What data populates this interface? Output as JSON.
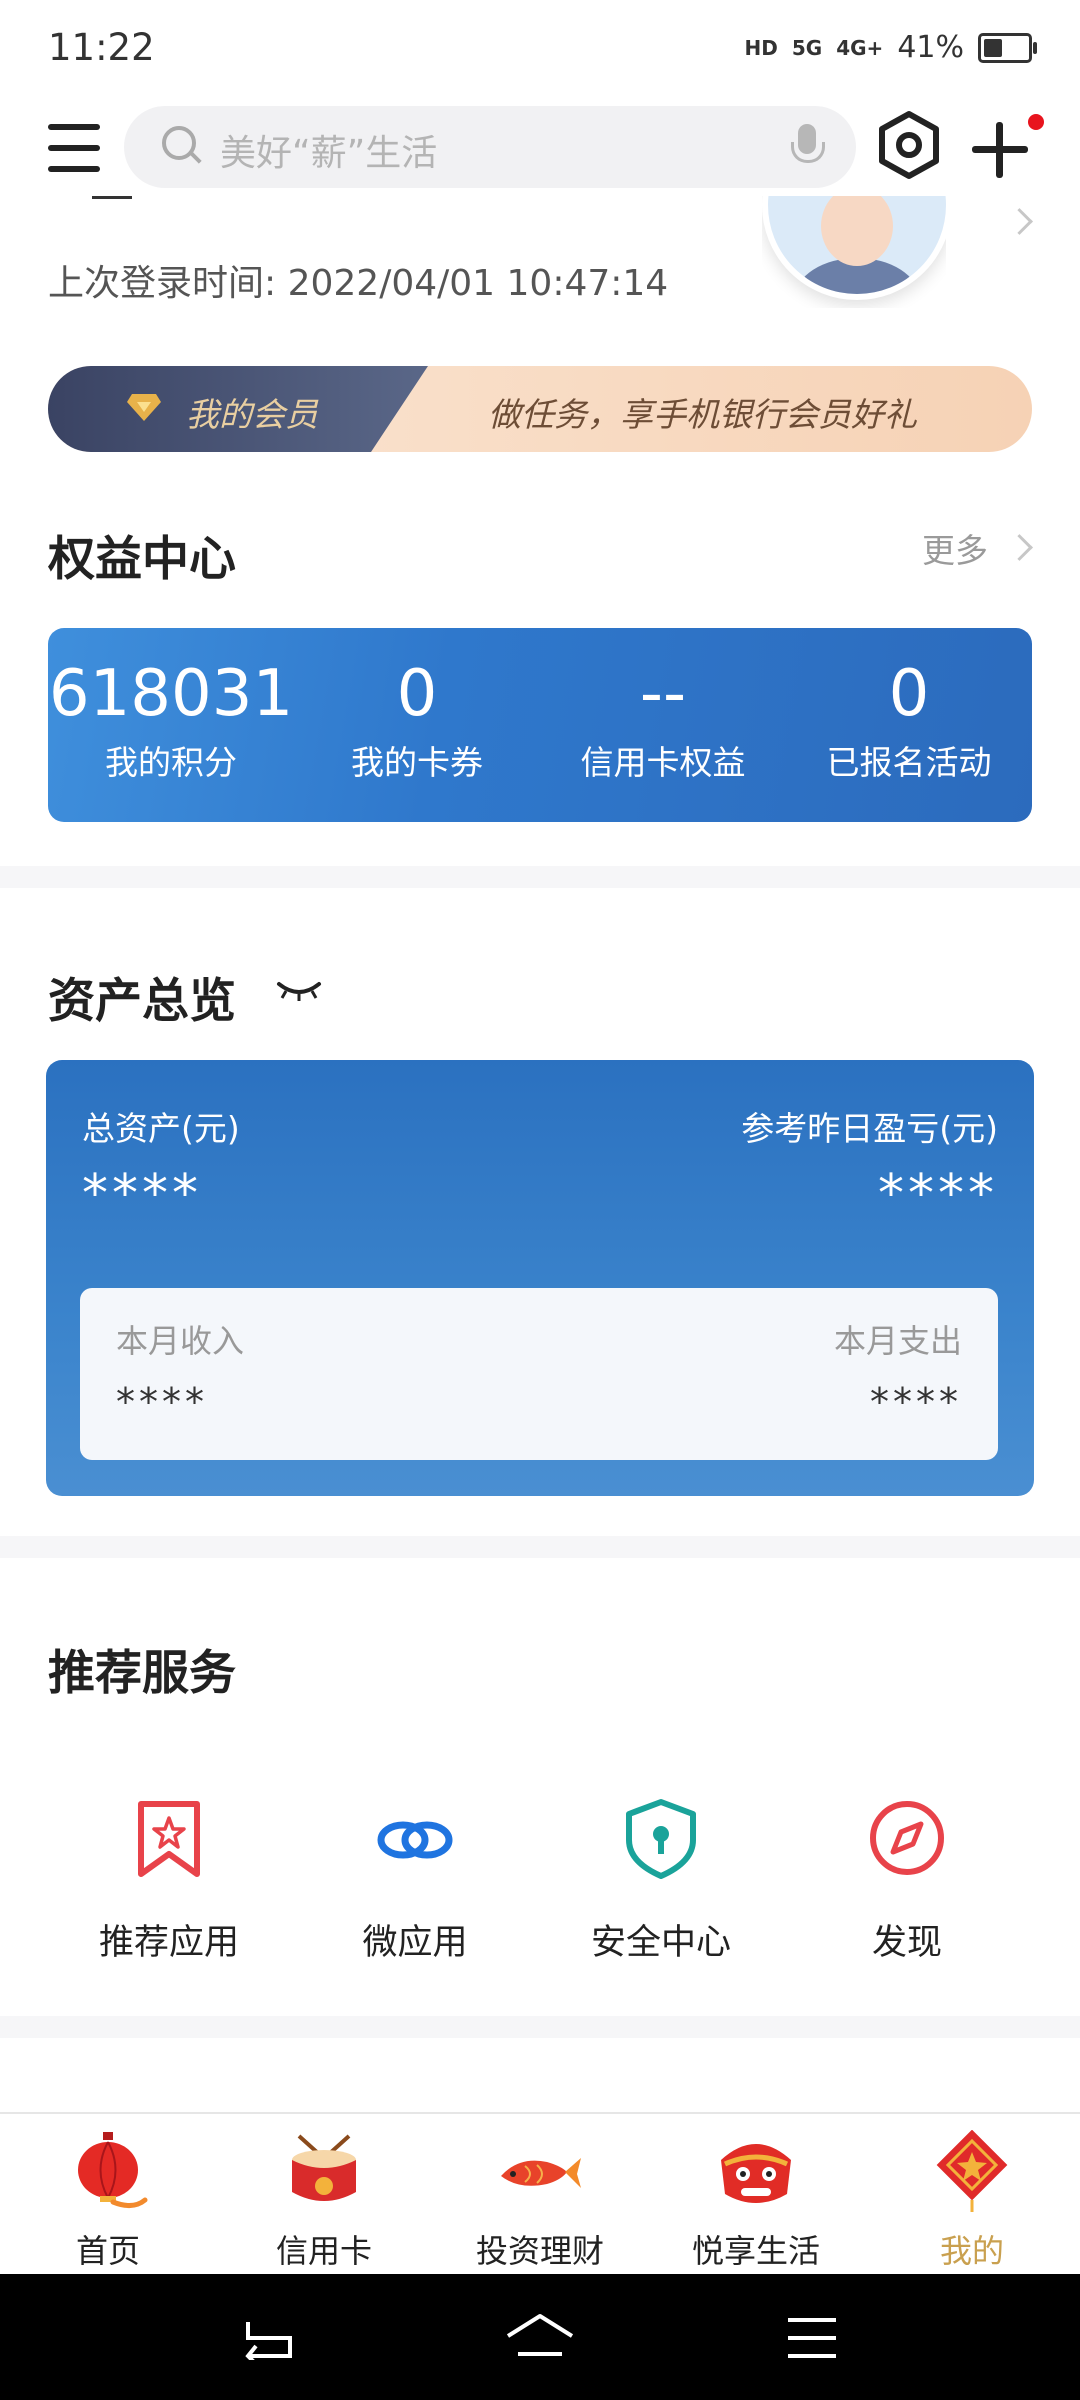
{
  "status_bar": {
    "time": "11:22",
    "network_1": "5G",
    "network_2": "4G+",
    "battery": "41%",
    "battery_level": 0.41
  },
  "header": {
    "search_placeholder": "美好“薪”生活"
  },
  "login": {
    "label": "上次登录时间:",
    "time": "2022/04/01 10:47:14"
  },
  "member": {
    "label": "我的会员",
    "promo": "做任务，享手机银行会员好礼"
  },
  "rights": {
    "title": "权益中心",
    "more": "更多",
    "items": [
      {
        "value": "618031",
        "label": "我的积分"
      },
      {
        "value": "0",
        "label": "我的卡券"
      },
      {
        "value": "--",
        "label": "信用卡权益"
      },
      {
        "value": "0",
        "label": "已报名活动"
      }
    ]
  },
  "assets": {
    "title": "资产总览",
    "total_label": "总资产(元)",
    "total_value": "****",
    "pnl_label": "参考昨日盈亏(元)",
    "pnl_value": "****",
    "income_label": "本月收入",
    "income_value": "****",
    "expense_label": "本月支出",
    "expense_value": "****"
  },
  "services": {
    "title": "推荐服务",
    "items": [
      {
        "label": "推荐应用",
        "icon": "bookmark-star-icon",
        "color": "#e8434a"
      },
      {
        "label": "微应用",
        "icon": "link-icon",
        "color": "#1f74e0"
      },
      {
        "label": "安全中心",
        "icon": "shield-lock-icon",
        "color": "#1aa39a"
      },
      {
        "label": "发现",
        "icon": "compass-icon",
        "color": "#e8434a"
      }
    ]
  },
  "tabs": [
    {
      "label": "首页",
      "icon": "lantern-icon",
      "active": false
    },
    {
      "label": "信用卡",
      "icon": "drum-icon",
      "active": false
    },
    {
      "label": "投资理财",
      "icon": "koi-fish-icon",
      "active": false
    },
    {
      "label": "悦享生活",
      "icon": "lion-dance-icon",
      "active": false
    },
    {
      "label": "我的",
      "icon": "fortune-icon",
      "active": true
    }
  ],
  "colors": {
    "accent": "#2c6fbf",
    "active_tab": "#c9a04f",
    "badge": "#e8141e"
  }
}
